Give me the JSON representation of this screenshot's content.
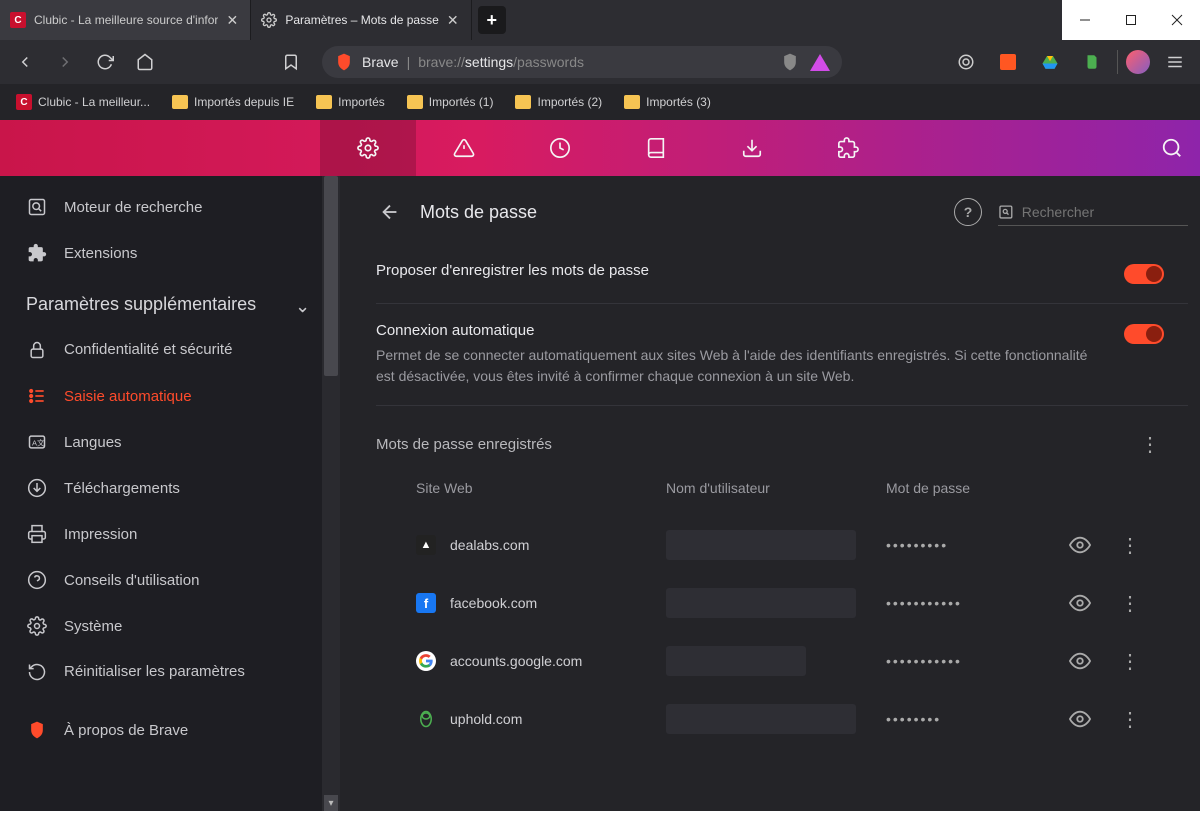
{
  "tabs": [
    {
      "title": "Clubic - La meilleure source d'infor"
    },
    {
      "title": "Paramètres – Mots de passe"
    }
  ],
  "address": {
    "brave_label": "Brave",
    "url_prefix": "brave://",
    "url_mid": "settings",
    "url_suffix": "/passwords"
  },
  "bookmarks": [
    {
      "label": "Clubic - La meilleur...",
      "icon": "clubic"
    },
    {
      "label": "Importés depuis IE",
      "icon": "folder"
    },
    {
      "label": "Importés",
      "icon": "folder"
    },
    {
      "label": "Importés (1)",
      "icon": "folder"
    },
    {
      "label": "Importés (2)",
      "icon": "folder"
    },
    {
      "label": "Importés (3)",
      "icon": "folder"
    }
  ],
  "sidebar": {
    "items_top": [
      {
        "label": "Moteur de recherche",
        "icon": "search-box"
      },
      {
        "label": "Extensions",
        "icon": "puzzle"
      }
    ],
    "section": "Paramètres supplémentaires",
    "items_bottom": [
      {
        "label": "Confidentialité et sécurité",
        "icon": "lock",
        "multiline": true
      },
      {
        "label": "Saisie automatique",
        "icon": "autofill",
        "active": true
      },
      {
        "label": "Langues",
        "icon": "lang"
      },
      {
        "label": "Téléchargements",
        "icon": "download"
      },
      {
        "label": "Impression",
        "icon": "print"
      },
      {
        "label": "Conseils d'utilisation",
        "icon": "help"
      },
      {
        "label": "Système",
        "icon": "gear"
      },
      {
        "label": "Réinitialiser les paramètres",
        "icon": "reset",
        "multiline": true
      },
      {
        "label": "À propos de Brave",
        "icon": "brave"
      }
    ]
  },
  "page": {
    "title": "Mots de passe",
    "search_placeholder": "Rechercher"
  },
  "settings": {
    "offer_save": {
      "title": "Proposer d'enregistrer les mots de passe"
    },
    "auto_signin": {
      "title": "Connexion automatique",
      "desc": "Permet de se connecter automatiquement aux sites Web à l'aide des identifiants enregistrés. Si cette fonctionnalité est désactivée, vous êtes invité à confirmer chaque connexion à un site Web."
    },
    "saved_section": "Mots de passe enregistrés",
    "columns": {
      "site": "Site Web",
      "user": "Nom d'utilisateur",
      "pass": "Mot de passe"
    },
    "rows": [
      {
        "site": "dealabs.com",
        "pass": "•••••••••",
        "fav": "dealabs"
      },
      {
        "site": "facebook.com",
        "pass": "•••••••••••",
        "fav": "facebook"
      },
      {
        "site": "accounts.google.com",
        "pass": "•••••••••••",
        "fav": "google"
      },
      {
        "site": "uphold.com",
        "pass": "••••••••",
        "fav": "uphold"
      }
    ]
  }
}
